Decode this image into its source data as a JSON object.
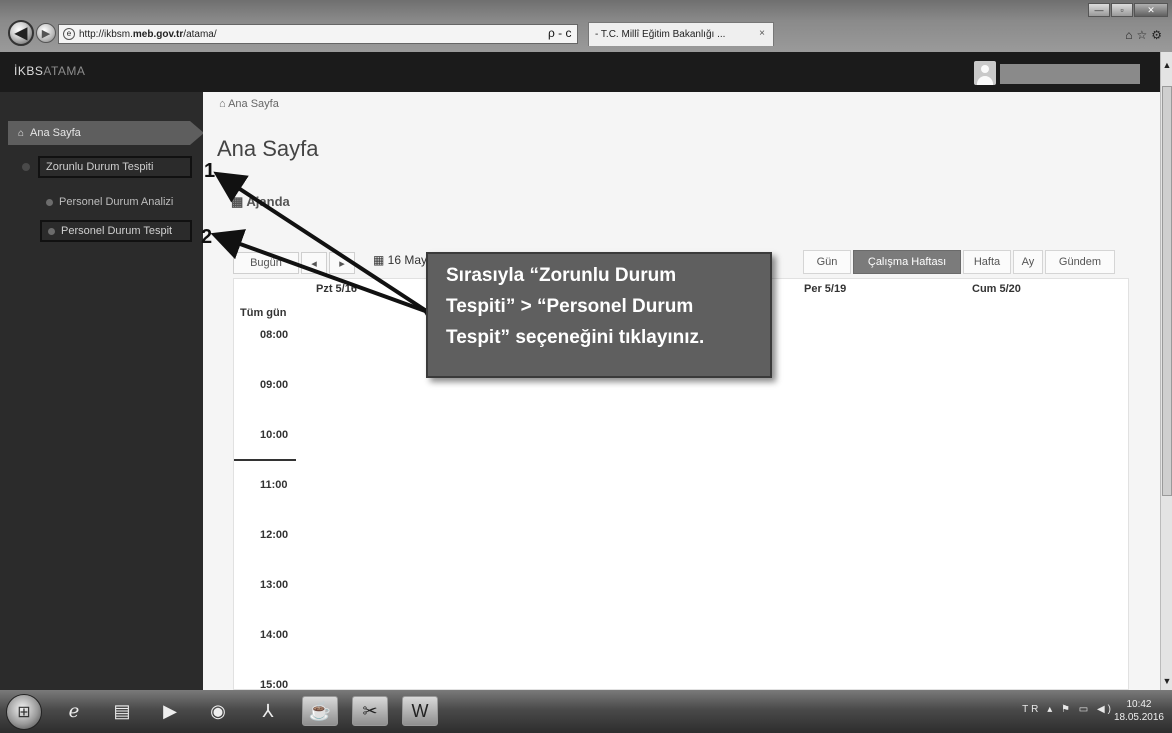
{
  "browser": {
    "url_prefix": "http://ikbsm.",
    "url_host": "meb.gov.tr",
    "url_path": "/atama/",
    "address_tools": "ρ - c",
    "tab_title": "- T.C. Millî Eğitim Bakanlığı ...",
    "tab_close": "×",
    "back_icon": "arrow-left-icon",
    "forward_icon": "arrow-right-icon"
  },
  "app": {
    "logo_strong": "İKBS",
    "logo_dim": "ATAMA"
  },
  "sidebar": {
    "items": [
      {
        "label": "Ana Sayfa",
        "icon": "home-icon"
      },
      {
        "label": "Zorunlu Durum Tespiti"
      },
      {
        "label": "Personel Durum Analizi"
      },
      {
        "label": "Personel Durum Tespit"
      }
    ]
  },
  "main": {
    "breadcrumb": "Ana Sayfa",
    "title": "Ana Sayfa",
    "section": "Ajanda"
  },
  "calendar": {
    "today_label": "Bugün",
    "prev_label": "◂",
    "next_label": "▸",
    "date_label": "16 Mayıs",
    "views": [
      "Gün",
      "Çalışma Haftası",
      "Hafta",
      "Ay",
      "Gündem"
    ],
    "active_view": "Çalışma Haftası",
    "day_headers": [
      "Pzt 5/16",
      "Per 5/19",
      "Cum 5/20"
    ],
    "all_day_label": "Tüm gün",
    "times": [
      "08:00",
      "09:00",
      "10:00",
      "11:00",
      "12:00",
      "13:00",
      "14:00",
      "15:00"
    ]
  },
  "callout": {
    "lines": [
      "Sırasıyla “Zorunlu Durum",
      "Tespiti” > “Personel Durum",
      "Tespit” seçeneğini tıklayınız."
    ],
    "marker_1": "1",
    "marker_2": "2"
  },
  "taskbar": {
    "lang": "TR",
    "time": "10:42",
    "date": "18.05.2016"
  }
}
